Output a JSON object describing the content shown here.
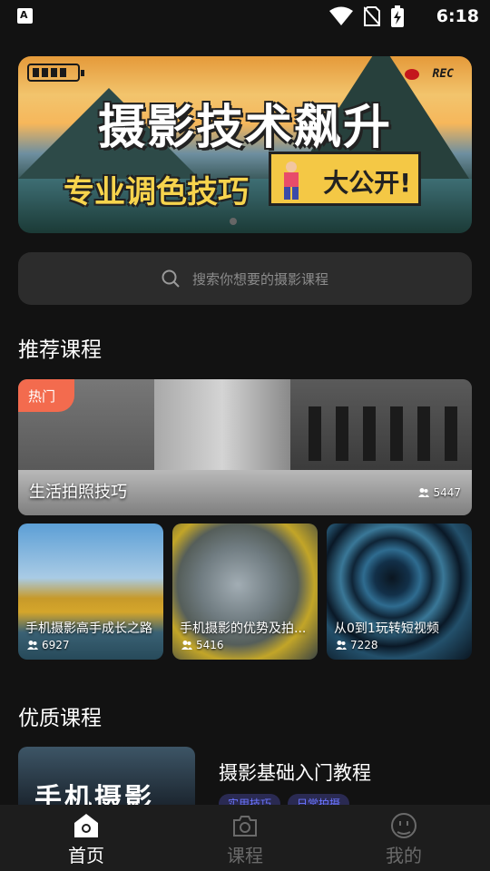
{
  "status_bar": {
    "time": "6:18",
    "left_icon_letter": "A"
  },
  "banner": {
    "title": "摄影技术飙升",
    "subtitle": "专业调色技巧",
    "badge": "大公开!",
    "rec": "REC"
  },
  "search": {
    "placeholder": "搜索你想要的摄影课程"
  },
  "recommended": {
    "title": "推荐课程",
    "featured": {
      "tag": "热门",
      "label": "生活拍照技巧",
      "count": "5447"
    },
    "cards": [
      {
        "label": "手机摄影高手成长之路",
        "count": "6927"
      },
      {
        "label": "手机摄影的优势及拍...",
        "count": "5416"
      },
      {
        "label": "从0到1玩转短视频",
        "count": "7228"
      }
    ]
  },
  "quality": {
    "title": "优质课程",
    "course": {
      "title": "摄影基础入门教程",
      "image_text": "手机摄影",
      "tags": [
        "实用技巧",
        "日常拍摄"
      ]
    }
  },
  "bottom_nav": [
    {
      "label": "首页",
      "icon": "home-icon",
      "active": true
    },
    {
      "label": "课程",
      "icon": "camera-icon",
      "active": false
    },
    {
      "label": "我的",
      "icon": "smiley-icon",
      "active": false
    }
  ],
  "colors": {
    "accent": "#f36b4e",
    "background": "#121212",
    "tag_text": "#6b75ff"
  }
}
